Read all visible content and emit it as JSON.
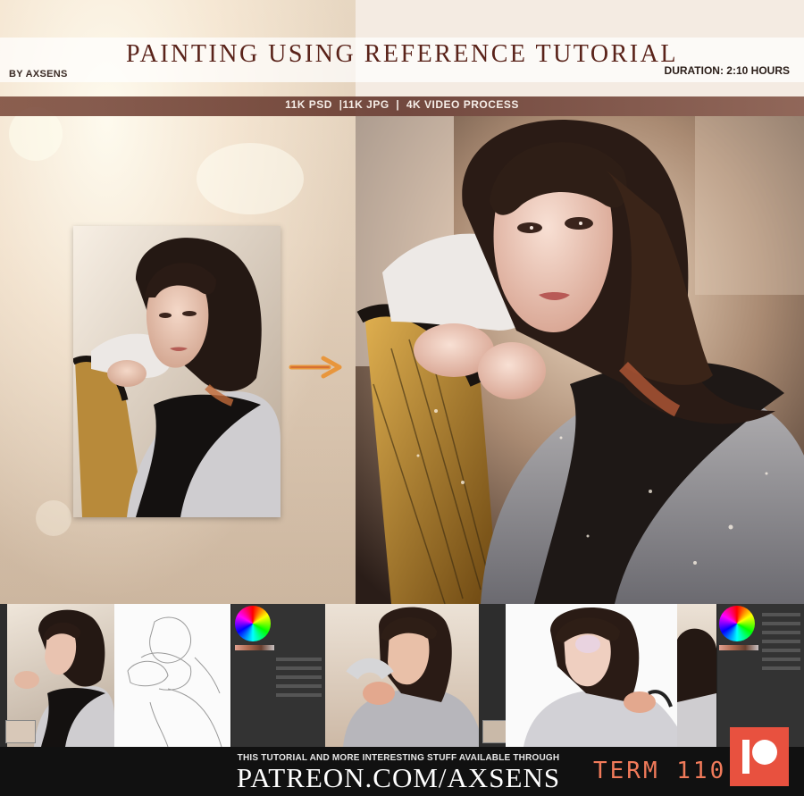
{
  "header": {
    "title": "PAINTING USING REFERENCE TUTORIAL",
    "author": "BY AXSENS",
    "duration": "DURATION: 2:10 HOURS",
    "specs": "11K PSD  |11K JPG  |  4K VIDEO PROCESS"
  },
  "footer": {
    "tagline": "THIS TUTORIAL AND MORE INTERESTING STUFF AVAILABLE THROUGH",
    "url": "PATREON.COM/AXSENS",
    "term": "TERM 110"
  },
  "icons": {
    "arrow": "right-arrow-icon",
    "brand": "patreon-icon"
  },
  "colors": {
    "title": "#5a231a",
    "spec_band": "#7a4a3a",
    "arrow": "#e8963c",
    "term": "#f07a5a",
    "patreon": "#e8513f"
  }
}
